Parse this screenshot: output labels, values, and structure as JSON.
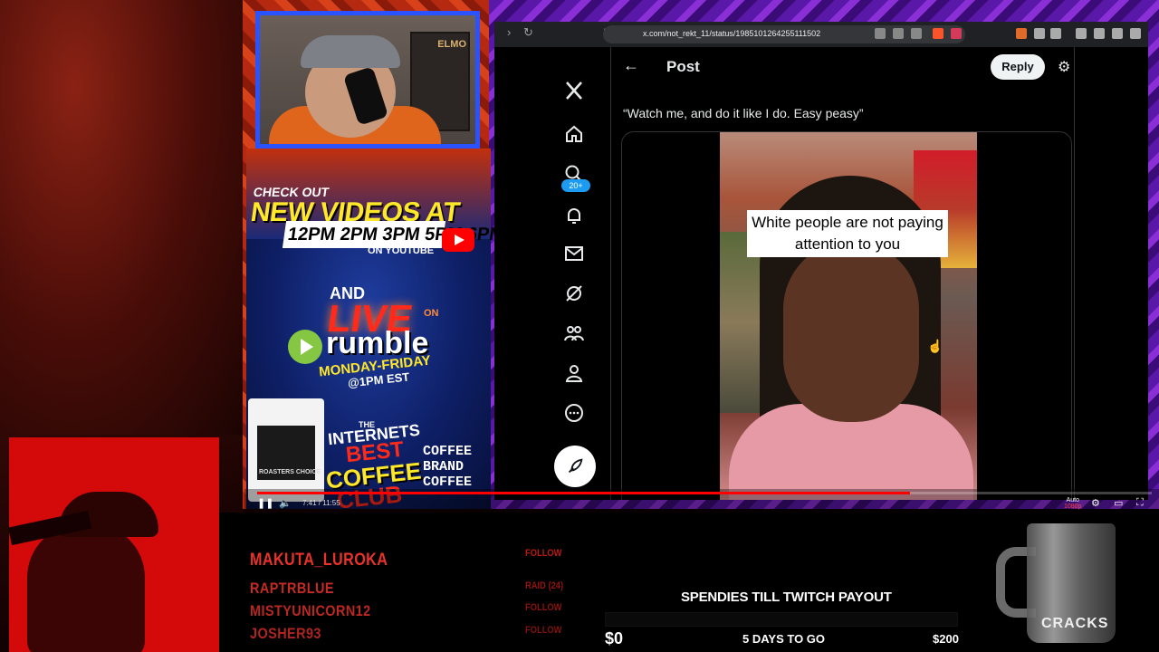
{
  "browser": {
    "url": "x.com/not_rekt_11/status/1985101264255111502"
  },
  "x": {
    "notifications_badge": "20+",
    "page_title": "Post",
    "reply_label": "Reply",
    "tweet_text": "“Watch me, and do it like I do. Easy peasy”",
    "video_caption": "White people are not paying attention to you",
    "icons": [
      "x-logo-icon",
      "home-icon",
      "search-icon",
      "bell-icon",
      "mail-icon",
      "grok-icon",
      "communities-icon",
      "profile-icon",
      "more-icon",
      "compose-icon"
    ]
  },
  "player": {
    "time": "7:41 / 11:55",
    "auto_label": "Auto",
    "quality": "1080p",
    "progress": 0.73
  },
  "promo": {
    "check_out": "CHECK OUT",
    "new_videos": "NEW VIDEOS AT",
    "times": "12PM 2PM 3PM 5PM 6PM",
    "on_youtube": "ON YOUTUBE",
    "and": "AND",
    "live": "LIVE",
    "on": "ON",
    "rumble": "rumble",
    "days": "MONDAY-FRIDAY",
    "time_est": "@1PM EST",
    "the": "THE",
    "internets": "INTERNETS",
    "best": "BEST",
    "coffee": "COFFEE",
    "club": "CLUB",
    "brand_lines": [
      "COFFEE",
      "BRAND",
      "COFFEE"
    ],
    "bag_label": "ROASTERS CHOICE"
  },
  "cam": {
    "sign": "ELMO"
  },
  "chat": [
    {
      "user": "MAKUTA_LUROKA",
      "event": "FOLLOW"
    },
    {
      "user": "RAPTRBLUE",
      "event": "RAID (24)"
    },
    {
      "user": "MISTYUNICORN12",
      "event": "FOLLOW"
    },
    {
      "user": "JOSHER93",
      "event": "FOLLOW"
    }
  ],
  "goal": {
    "title": "SPENDIES TILL TWITCH PAYOUT",
    "min": "$0",
    "remaining": "5 DAYS TO GO",
    "max": "$200",
    "progress": 0
  },
  "mug_logo": "CRACKS"
}
